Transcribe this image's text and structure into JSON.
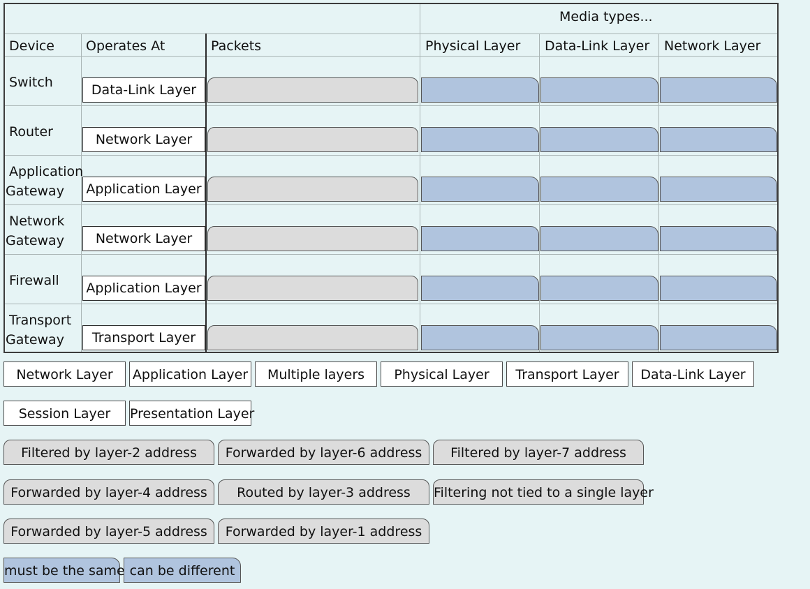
{
  "table": {
    "media_header": "Media types...",
    "columns": {
      "device": "Device",
      "operates_at": "Operates At",
      "packets": "Packets",
      "physical": "Physical Layer",
      "datalink": "Data-Link Layer",
      "network": "Network Layer"
    },
    "rows": [
      {
        "device": [
          "Switch"
        ],
        "operates_at": "Data-Link Layer"
      },
      {
        "device": [
          "Router"
        ],
        "operates_at": "Network Layer"
      },
      {
        "device": [
          "Application",
          "Gateway"
        ],
        "operates_at": "Application Layer"
      },
      {
        "device": [
          "Network",
          "Gateway"
        ],
        "operates_at": "Network Layer"
      },
      {
        "device": [
          "Firewall"
        ],
        "operates_at": "Application Layer"
      },
      {
        "device": [
          "Transport",
          "Gateway"
        ],
        "operates_at": "Transport Layer"
      }
    ]
  },
  "palette": {
    "layers": [
      "Network Layer",
      "Application Layer",
      "Multiple layers",
      "Physical Layer",
      "Transport Layer",
      "Data-Link Layer",
      "Session Layer",
      "Presentation Layer"
    ],
    "packets": [
      "Filtered by layer-2 address",
      "Forwarded by layer-6 address",
      "Filtered by layer-7 address",
      "Forwarded by layer-4 address",
      "Routed by layer-3 address",
      "Filtering not tied to a single layer",
      "Forwarded by layer-5 address",
      "Forwarded by layer-1 address"
    ],
    "media": [
      "must be the same",
      "can be different"
    ]
  },
  "colors": {
    "background": "#e6f4f5",
    "packet_tile": "#dcdcdc",
    "media_tile": "#b0c4de",
    "layer_tile": "#ffffff"
  }
}
